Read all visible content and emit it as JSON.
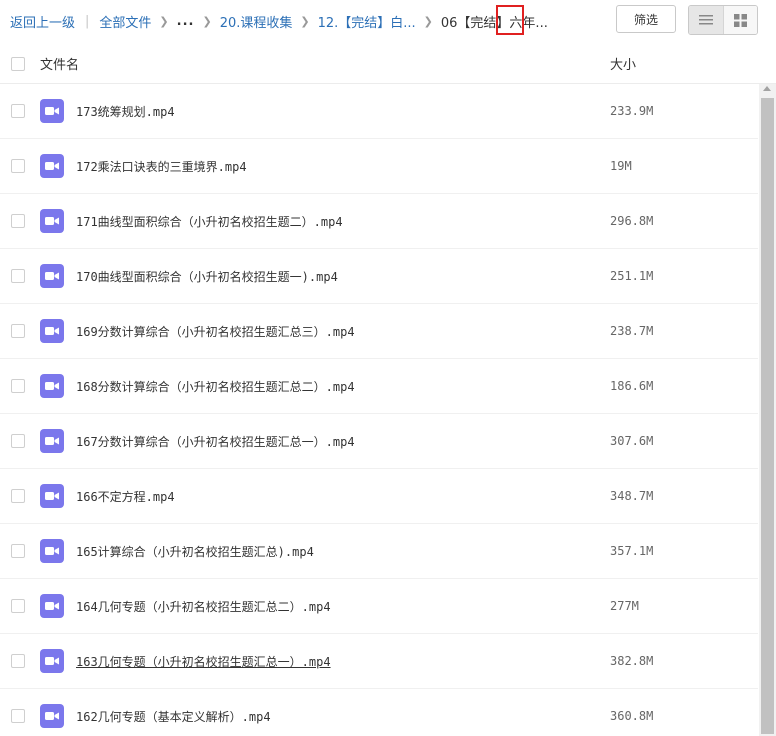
{
  "breadcrumb": {
    "back": "返回上一级",
    "separator": "|",
    "all_files": "全部文件",
    "ellipsis": "...",
    "crumb_1": "20.课程收集",
    "crumb_2": "12.【完结】白...",
    "current": "06【完结】六年..."
  },
  "toolbar": {
    "filter_label": "筛选",
    "view_list_icon": "list-icon",
    "view_grid_icon": "grid-icon"
  },
  "table": {
    "col_name": "文件名",
    "col_size": "大小",
    "rows": [
      {
        "name": "173统筹规划.mp4",
        "size": "233.9M"
      },
      {
        "name": "172乘法口诀表的三重境界.mp4",
        "size": "19M"
      },
      {
        "name": "171曲线型面积综合（小升初名校招生题二）.mp4",
        "size": "296.8M"
      },
      {
        "name": "170曲线型面积综合（小升初名校招生题一).mp4",
        "size": "251.1M"
      },
      {
        "name": "169分数计算综合（小升初名校招生题汇总三）.mp4",
        "size": "238.7M"
      },
      {
        "name": "168分数计算综合（小升初名校招生题汇总二）.mp4",
        "size": "186.6M"
      },
      {
        "name": "167分数计算综合（小升初名校招生题汇总一）.mp4",
        "size": "307.6M"
      },
      {
        "name": "166不定方程.mp4",
        "size": "348.7M"
      },
      {
        "name": "165计算综合（小升初名校招生题汇总).mp4",
        "size": "357.1M"
      },
      {
        "name": "164几何专题（小升初名校招生题汇总二）.mp4",
        "size": "277M"
      },
      {
        "name": "163几何专题（小升初名校招生题汇总一）.mp4",
        "size": "382.8M"
      },
      {
        "name": "162几何专题（基本定义解析）.mp4",
        "size": "360.8M"
      }
    ]
  },
  "colors": {
    "video_icon": "#7b77ec",
    "link": "#2b6fb6",
    "highlight": "#e02020"
  }
}
